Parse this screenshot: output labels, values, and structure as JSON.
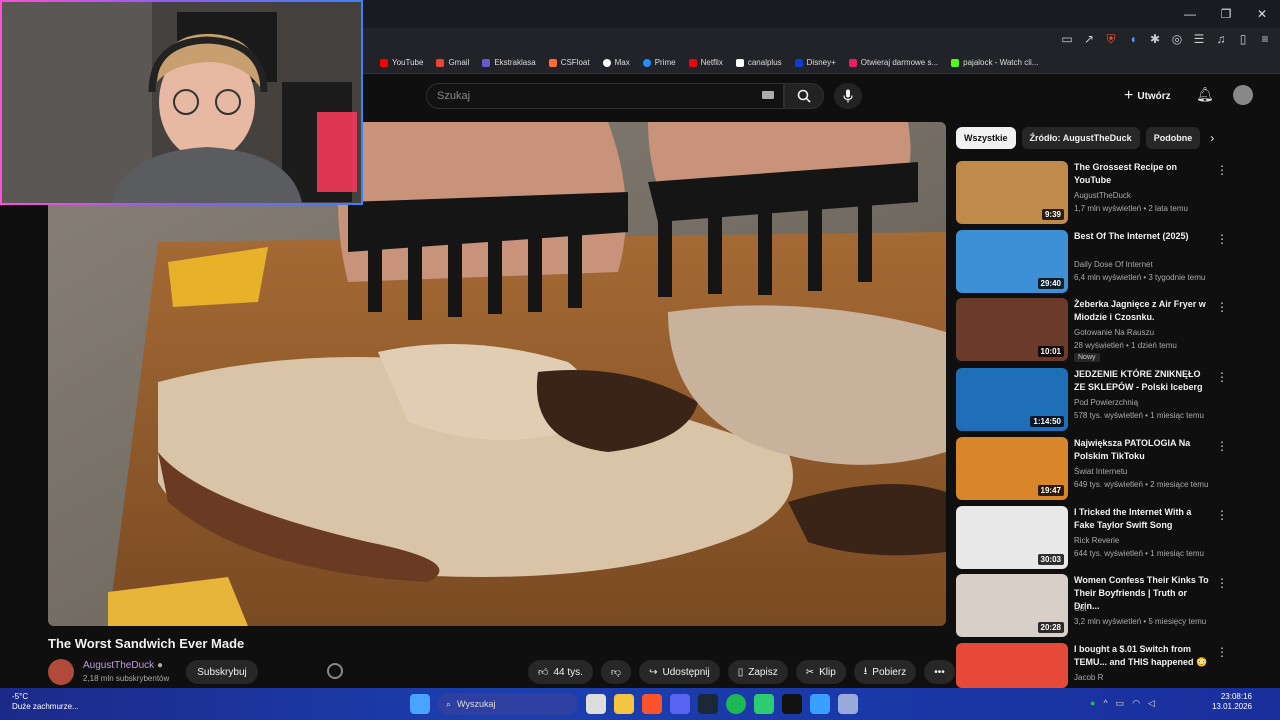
{
  "window": {
    "minimize": "—",
    "maximize": "❐",
    "close": "✕"
  },
  "bookmarks": [
    {
      "label": "YouTube",
      "color": "#ff0000"
    },
    {
      "label": "Gmail",
      "color": "#ea4335"
    },
    {
      "label": "Ekstraklasa",
      "color": "#6a5acd"
    },
    {
      "label": "CSFloat",
      "color": "#ff6b35"
    },
    {
      "label": "Max",
      "color": "#ffffff"
    },
    {
      "label": "Prime",
      "color": "#1e90ff"
    },
    {
      "label": "Netflix",
      "color": "#e50914"
    },
    {
      "label": "canalplus",
      "color": "#ffffff"
    },
    {
      "label": "Disney+",
      "color": "#113ccf"
    },
    {
      "label": "Otwieraj darmowe s...",
      "color": "#e91e63"
    },
    {
      "label": "pajalock - Watch cli...",
      "color": "#53fc18"
    }
  ],
  "header": {
    "search_placeholder": "Szukaj",
    "create_label": "Utwórz"
  },
  "video": {
    "title": "The Worst Sandwich Ever Made",
    "channel": "AugustTheDuck",
    "subscribers": "2,18 mln subskrybentów",
    "subscribe_label": "Subskrybuj",
    "likes": "44 tys.",
    "share_label": "Udostępnij",
    "save_label": "Zapisz",
    "clip_label": "Klip",
    "download_label": "Pobierz",
    "more_label": "•••"
  },
  "sidebar": {
    "chips": [
      "Wszystkie",
      "Źródło: AugustTheDuck",
      "Podobne"
    ],
    "recommendations": [
      {
        "title": "The Grossest Recipe on YouTube",
        "channel": "AugustTheDuck",
        "meta": "1,7 mln wyświetleń • 2 lata temu",
        "duration": "9:39",
        "badge": "",
        "thumb": "#c08a4a"
      },
      {
        "title": "Best Of The Internet (2025)",
        "channel": "Daily Dose Of Internet",
        "meta": "6,4 mln wyświetleń • 3 tygodnie temu",
        "duration": "29:40",
        "badge": "",
        "thumb": "#3d8fd6"
      },
      {
        "title": "Żeberka Jagnięce z Air Fryer w Miodzie i Czosnku.",
        "channel": "Gotowanie Na Rauszu",
        "meta": "28 wyświetleń • 1 dzień temu",
        "duration": "10:01",
        "badge": "Nowy",
        "thumb": "#6b3a2a"
      },
      {
        "title": "JEDZENIE KTÓRE ZNIKNĘŁO ZE SKLEPÓW - Polski Iceberg",
        "channel": "Pod Powierzchnią",
        "meta": "578 tys. wyświetleń • 1 miesiąc temu",
        "duration": "1:14:50",
        "badge": "",
        "thumb": "#1e6fb8"
      },
      {
        "title": "Największa PATOLOGIA Na Polskim TikToku",
        "channel": "Świat Internetu",
        "meta": "649 tys. wyświetleń • 2 miesiące temu",
        "duration": "19:47",
        "badge": "",
        "thumb": "#d9852a"
      },
      {
        "title": "I Tricked the Internet With a Fake Taylor Swift Song",
        "channel": "Rick Reverie",
        "meta": "644 tys. wyświetleń • 1 miesiąc temu",
        "duration": "30:03",
        "badge": "",
        "thumb": "#e8e8e8"
      },
      {
        "title": "Women Confess Their Kinks To Their Boyfriends | Truth or Drin...",
        "channel": "Cut",
        "meta": "3,2 mln wyświetleń • 5 miesięcy temu",
        "duration": "20:28",
        "badge": "",
        "thumb": "#d8d0c8"
      },
      {
        "title": "I bought a $.01 Switch from TEMU... and THIS happened 😳",
        "channel": "Jacob R",
        "meta": "",
        "duration": "",
        "badge": "",
        "thumb": "#e84a3a"
      }
    ]
  },
  "taskbar": {
    "weather_temp": "-5°C",
    "weather_desc": "Duże zachmurze...",
    "search_label": "Wyszukaj",
    "time": "23:08:16",
    "date": "13.01.2026"
  }
}
